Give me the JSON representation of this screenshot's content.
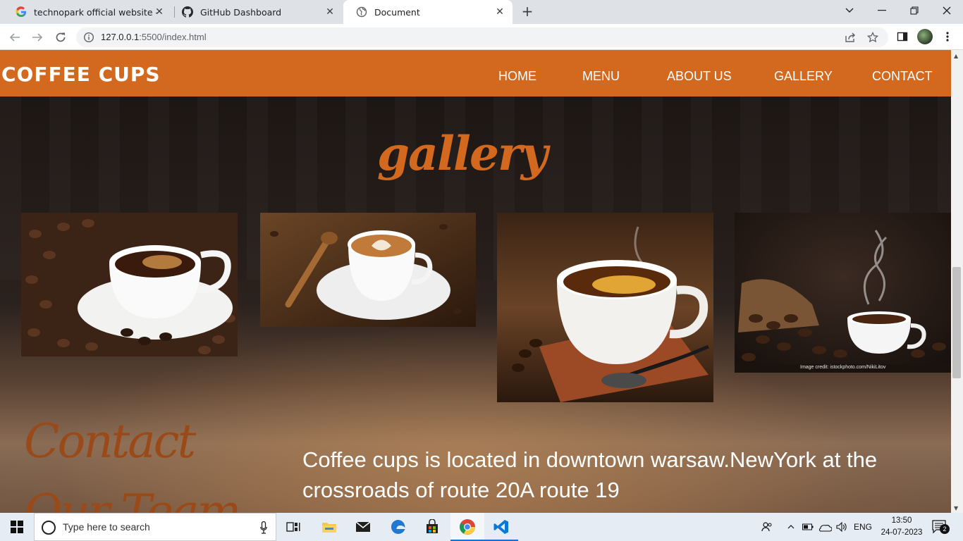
{
  "browser": {
    "tabs": [
      {
        "title": "technopark official website - Goo",
        "icon": "google-icon",
        "active": false
      },
      {
        "title": "GitHub Dashboard",
        "icon": "github-icon",
        "active": false
      },
      {
        "title": "Document",
        "icon": "globe-icon",
        "active": true
      }
    ],
    "new_tab_label": "+",
    "close_glyph": "✕",
    "url_host": "127.0.0.1",
    "url_path": ":5500/index.html",
    "window_controls": [
      "chevron-down-icon",
      "minimize-icon",
      "restore-icon",
      "close-icon"
    ]
  },
  "site": {
    "brand": "COFFEE CUPS",
    "nav": [
      "HOME",
      "MENU",
      "ABOUT US",
      "GALLERY",
      "CONTACT"
    ],
    "gallery_title": "gallery",
    "photo_credit": "Image credit: istockphoto.com/NikiLitov",
    "contact_title": "Contact Our Team",
    "contact_text": "Coffee cups is located in downtown warsaw.NewYork at the crossroads of route 20A route 19",
    "accent_color": "#d2691e"
  },
  "taskbar": {
    "search_placeholder": "Type here to search",
    "language": "ENG",
    "time": "13:50",
    "date": "24-07-2023",
    "notification_count": "2"
  }
}
